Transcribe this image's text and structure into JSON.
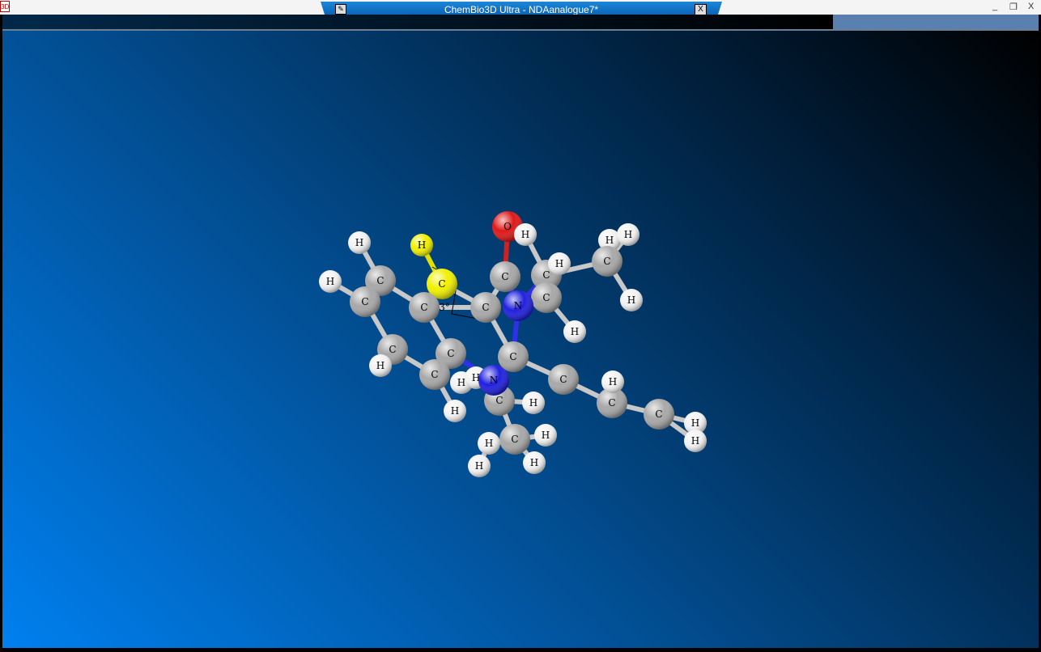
{
  "window": {
    "title": "ChemBio3D Ultra - NDAanalogue7*",
    "app_icon": "3D",
    "doc_icon": "document-icon",
    "close_glyph": "X",
    "minimize_glyph": "_",
    "restore_glyph": "❐",
    "app_close_glyph": "X"
  },
  "viewer": {
    "angle_label": "3°",
    "colors": {
      "C": "#a8a8a8",
      "H": "#f2f2f2",
      "N": "#2020e0",
      "O": "#e01818",
      "S": "#f0f000"
    },
    "atoms": [
      {
        "label": "O",
        "color": "O"
      },
      {
        "label": "H",
        "color": "H"
      },
      {
        "label": "H",
        "color": "H"
      },
      {
        "label": "H",
        "color": "H"
      },
      {
        "label": "C",
        "color": "C"
      },
      {
        "label": "C",
        "color": "C"
      },
      {
        "label": "H",
        "color": "H"
      },
      {
        "label": "C",
        "color": "C"
      },
      {
        "label": "H",
        "color": "H"
      },
      {
        "label": "H",
        "color": "H"
      },
      {
        "label": "N",
        "color": "N"
      },
      {
        "label": "C",
        "color": "C"
      },
      {
        "label": "C",
        "color": "C"
      },
      {
        "label": "C",
        "color": "S"
      },
      {
        "label": "H",
        "color": "S"
      },
      {
        "label": "H",
        "color": "H"
      },
      {
        "label": "H",
        "color": "H"
      },
      {
        "label": "C",
        "color": "C"
      },
      {
        "label": "C",
        "color": "C"
      },
      {
        "label": "C",
        "color": "C"
      },
      {
        "label": "C",
        "color": "C"
      },
      {
        "label": "H",
        "color": "H"
      },
      {
        "label": "C",
        "color": "C"
      },
      {
        "label": "C",
        "color": "C"
      },
      {
        "label": "H",
        "color": "H"
      },
      {
        "label": "C",
        "color": "C"
      },
      {
        "label": "H",
        "color": "H"
      },
      {
        "label": "H",
        "color": "H"
      },
      {
        "label": "C",
        "color": "C"
      },
      {
        "label": "N",
        "color": "N"
      },
      {
        "label": "H",
        "color": "H"
      },
      {
        "label": "C",
        "color": "C"
      },
      {
        "label": "H",
        "color": "H"
      },
      {
        "label": "H",
        "color": "H"
      },
      {
        "label": "H",
        "color": "H"
      },
      {
        "label": "H",
        "color": "H"
      },
      {
        "label": "C",
        "color": "C"
      },
      {
        "label": "C",
        "color": "C"
      },
      {
        "label": "H",
        "color": "H"
      },
      {
        "label": "C",
        "color": "C"
      },
      {
        "label": "H",
        "color": "H"
      },
      {
        "label": "H",
        "color": "H"
      }
    ]
  }
}
